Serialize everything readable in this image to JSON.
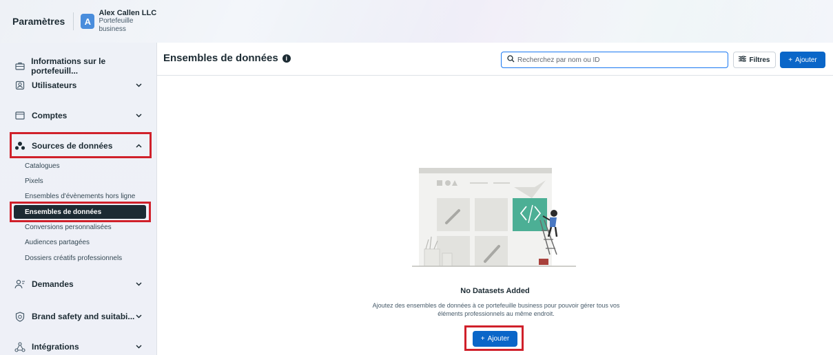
{
  "header": {
    "title": "Paramètres",
    "avatar_letter": "A",
    "business_name": "Alex Callen LLC",
    "business_type": "Portefeuille business"
  },
  "sidebar": {
    "items": [
      {
        "label": "Informations sur le portefeuill...",
        "icon": "briefcase-icon"
      },
      {
        "label": "Utilisateurs",
        "icon": "users-icon",
        "chevron": "chevron-down-icon"
      },
      {
        "label": "Comptes",
        "icon": "inbox-icon",
        "chevron": "chevron-down-icon"
      },
      {
        "label": "Sources de données",
        "icon": "data-sources-icon",
        "chevron": "chevron-up-icon"
      },
      {
        "label": "Demandes",
        "icon": "person-request-icon",
        "chevron": "chevron-down-icon"
      },
      {
        "label": "Brand safety and suitabi...",
        "icon": "shield-icon",
        "chevron": "chevron-down-icon"
      },
      {
        "label": "Intégrations",
        "icon": "integrations-icon",
        "chevron": "chevron-down-icon"
      }
    ],
    "sub_items": [
      "Catalogues",
      "Pixels",
      "Ensembles d'évènements hors ligne",
      "Ensembles de données",
      "Conversions personnalisées",
      "Audiences partagées",
      "Dossiers créatifs professionnels"
    ],
    "active_sub_item": "Ensembles de données"
  },
  "main": {
    "title": "Ensembles de données",
    "info_icon": "i",
    "search_placeholder": "Recherchez par nom ou ID",
    "filters_label": "Filtres",
    "add_label": "Ajouter",
    "empty_title": "No Datasets Added",
    "empty_description": "Ajoutez des ensembles de données à ce portefeuille business pour pouvoir gérer tous vos éléments professionnels au même endroit.",
    "empty_add_label": "Ajouter"
  },
  "colors": {
    "primary": "#0a66c8",
    "highlight": "#d0202a",
    "active_nav": "#1c2b33"
  }
}
